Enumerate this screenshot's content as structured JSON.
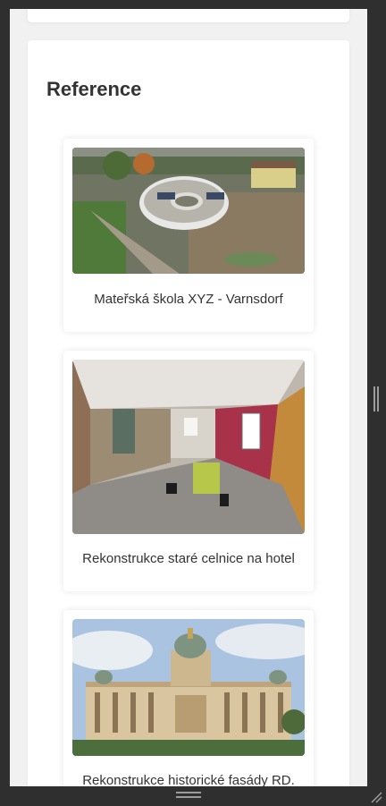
{
  "section": {
    "title": "Reference"
  },
  "references": [
    {
      "caption": "Mateřská škola XYZ - Varnsdorf",
      "image": "aerial-kindergarten-construction"
    },
    {
      "caption": "Rekonstrukce staré celnice na hotel",
      "image": "interior-renovation-room"
    },
    {
      "caption": "Rekonstrukce historické fasády RD.",
      "image": "historic-museum-facade"
    }
  ],
  "colors": {
    "frame": "#2f2f2f",
    "page_bg": "#f1f1f1",
    "card_bg": "#ffffff",
    "text": "#333333"
  }
}
